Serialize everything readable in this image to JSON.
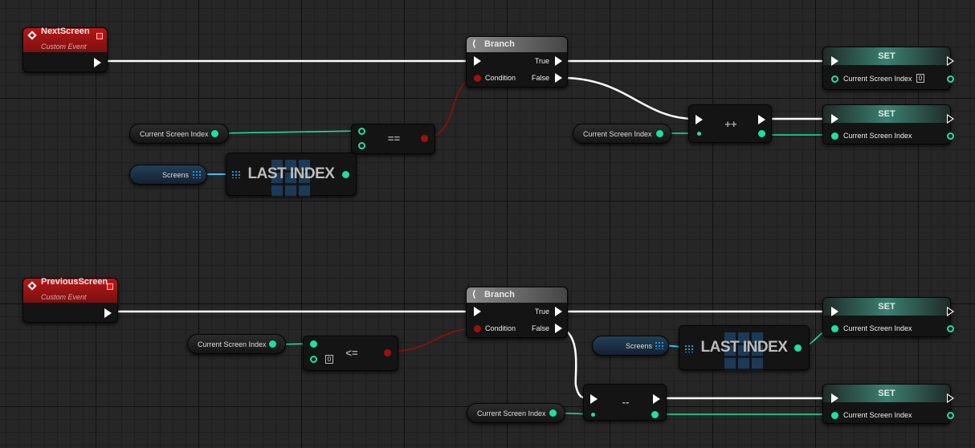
{
  "graph": {
    "events": [
      {
        "title": "NextScreen",
        "subtitle": "Custom Event"
      },
      {
        "title": "PreviousScreen",
        "subtitle": "Custom Event"
      }
    ],
    "branch": {
      "title": "Branch",
      "pin_condition": "Condition",
      "pin_true": "True",
      "pin_false": "False"
    },
    "set": {
      "title": "SET",
      "pin_label": "Current Screen Index",
      "default_value": "0"
    },
    "variables": {
      "current_screen_index": "Current Screen Index",
      "screens": "Screens"
    },
    "operators": {
      "equals": "==",
      "increment": "++",
      "decrement": "--",
      "less_equal": "<=",
      "last_index": "LAST INDEX"
    },
    "literal_zero": "0"
  },
  "colors": {
    "exec_wire": "#ffffff",
    "integer_wire": "#1ee0a0",
    "boolean_wire": "#8f0f0f",
    "array_wire": "#3cc0ff",
    "event_header": "#a51515",
    "set_header": "#3a8070"
  },
  "icons": [
    "diamond-event-icon",
    "delegate-icon",
    "branch-icon",
    "array-grid-icon",
    "exec-pin-icon"
  ]
}
